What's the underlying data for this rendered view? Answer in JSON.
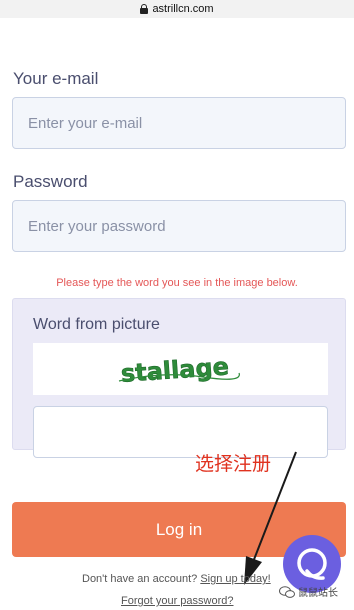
{
  "browser": {
    "url": "astrillcn.com"
  },
  "form": {
    "email_label": "Your e-mail",
    "email_placeholder": "Enter your e-mail",
    "password_label": "Password",
    "password_placeholder": "Enter your password",
    "captcha_error": "Please type the word you see in the image below.",
    "captcha_label": "Word from picture",
    "captcha_word": "stallage",
    "captcha_value": "",
    "login_label": "Log in",
    "signup_prompt": "Don't have an account?",
    "signup_link": "Sign up today!",
    "forgot_link": "Forgot your password?"
  },
  "annotation": {
    "text": "选择注册"
  },
  "watermark": {
    "text": "鼠鼠站长"
  },
  "colors": {
    "accent": "#ee7a52",
    "error": "#e45757",
    "annotation": "#e0321f",
    "chat": "#6b5fe0",
    "captcha_text": "#2e8b3a"
  },
  "icons": [
    "lock-icon",
    "chat-bubble-icon",
    "arrow-icon",
    "wechat-icon"
  ]
}
